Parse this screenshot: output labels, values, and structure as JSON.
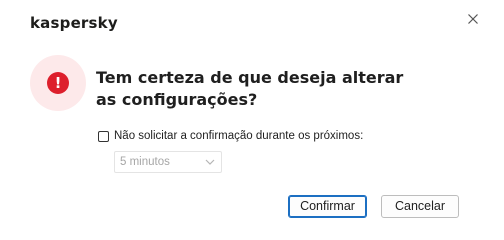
{
  "window": {
    "brand": "kaspersky"
  },
  "dialog": {
    "question": "Tem certeza de que deseja alterar as configurações?",
    "dont_ask": {
      "label": "Não solicitar a confirmação durante os próximos:",
      "checked": false
    },
    "duration": {
      "value": "5 minutos",
      "enabled": false
    },
    "buttons": {
      "confirm": "Confirmar",
      "cancel": "Cancelar"
    }
  },
  "icons": {
    "alert": "exclamation-circle-icon",
    "close": "close-icon",
    "dropdown": "chevron-down-icon"
  },
  "colors": {
    "alert_red": "#dd1f2c",
    "alert_bg": "#fde9ea",
    "primary_border": "#1c6fc2"
  }
}
